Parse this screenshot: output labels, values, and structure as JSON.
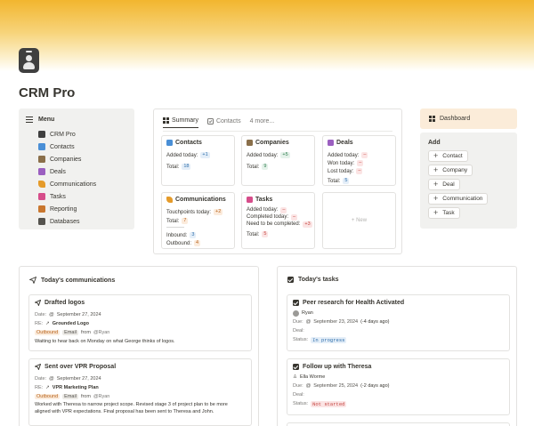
{
  "page": {
    "title": "CRM Pro"
  },
  "menu": {
    "heading": "Menu",
    "items": [
      {
        "label": "CRM Pro",
        "icon": "crm-badge-icon"
      },
      {
        "label": "Contacts",
        "icon": "contact-card-icon"
      },
      {
        "label": "Companies",
        "icon": "building-icon"
      },
      {
        "label": "Deals",
        "icon": "money-icon"
      },
      {
        "label": "Communications",
        "icon": "paper-plane-icon"
      },
      {
        "label": "Tasks",
        "icon": "checkbox-icon"
      },
      {
        "label": "Reporting",
        "icon": "chart-icon"
      },
      {
        "label": "Databases",
        "icon": "stack-icon"
      }
    ]
  },
  "board": {
    "tabs": [
      {
        "label": "Summary"
      },
      {
        "label": "Contacts"
      },
      {
        "label": "4 more..."
      }
    ],
    "contacts": {
      "title": "Contacts",
      "added_today_label": "Added today:",
      "added_today": "+1",
      "total_label": "Total:",
      "total": "18"
    },
    "companies": {
      "title": "Companies",
      "added_today_label": "Added today:",
      "added_today": "+5",
      "total_label": "Total:",
      "total": "9"
    },
    "deals": {
      "title": "Deals",
      "added_today_label": "Added today:",
      "added_today": "–",
      "won_today_label": "Won today:",
      "won_today": "–",
      "lost_today_label": "Lost today:",
      "lost_today": "–",
      "total_label": "Total:",
      "total": "5"
    },
    "communications": {
      "title": "Communications",
      "touchpoints_label": "Touchpoints today:",
      "touchpoints": "+2",
      "total_label": "Total:",
      "total": "7",
      "divider": "----------",
      "inbound_label": "Inbound:",
      "inbound": "3",
      "outbound_label": "Outbound:",
      "outbound": "4"
    },
    "tasks": {
      "title": "Tasks",
      "added_today_label": "Added today:",
      "added_today": "–",
      "completed_today_label": "Completed today:",
      "completed_today": "–",
      "need_completed_label": "Need to be completed:",
      "need_completed": "+3",
      "total_label": "Total:",
      "total": "5"
    },
    "new_label": "+ New"
  },
  "dashboard_button": "Dashboard",
  "add": {
    "title": "Add",
    "buttons": [
      "Contact",
      "Company",
      "Deal",
      "Communication",
      "Task"
    ]
  },
  "communications_section": {
    "title": "Today's communications",
    "items": [
      {
        "title": "Drafted logos",
        "date_label": "Date:",
        "date": "September 27, 2024",
        "re_label": "RE:",
        "re": "Grounded Logo",
        "direction": "Outbound",
        "channel": "Email",
        "from_label": "from",
        "from": "@Ryan",
        "note": "Waiting to hear back on Monday on what George thinks of logos."
      },
      {
        "title": "Sent over VPR Proposal",
        "date_label": "Date:",
        "date": "September 27, 2024",
        "re_label": "RE:",
        "re": "VPR Marketing Plan",
        "direction": "Outbound",
        "channel": "Email",
        "from_label": "from",
        "from": "@Ryan",
        "note": "Worked with Theresa to narrow project scope. Revised stage 3 of project plan to be more aligned with VPR expectations. Final proposal has been sent to Theresa and John."
      }
    ]
  },
  "tasks_section": {
    "title": "Today's tasks",
    "items": [
      {
        "title": "Peer research for Health Activated",
        "assignee": "Ryan",
        "due_label": "Due:",
        "due": "September 23, 2024",
        "due_rel": "(-4 days ago)",
        "deal_label": "Deal:",
        "status_label": "Status:",
        "status": "In progress"
      },
      {
        "title": "Follow up with Theresa",
        "assignee": "Ella Worme",
        "due_label": "Due:",
        "due": "September 25, 2024",
        "due_rel": "(-2 days ago)",
        "deal_label": "Deal:",
        "status_label": "Status:",
        "status": "Not started"
      }
    ]
  }
}
